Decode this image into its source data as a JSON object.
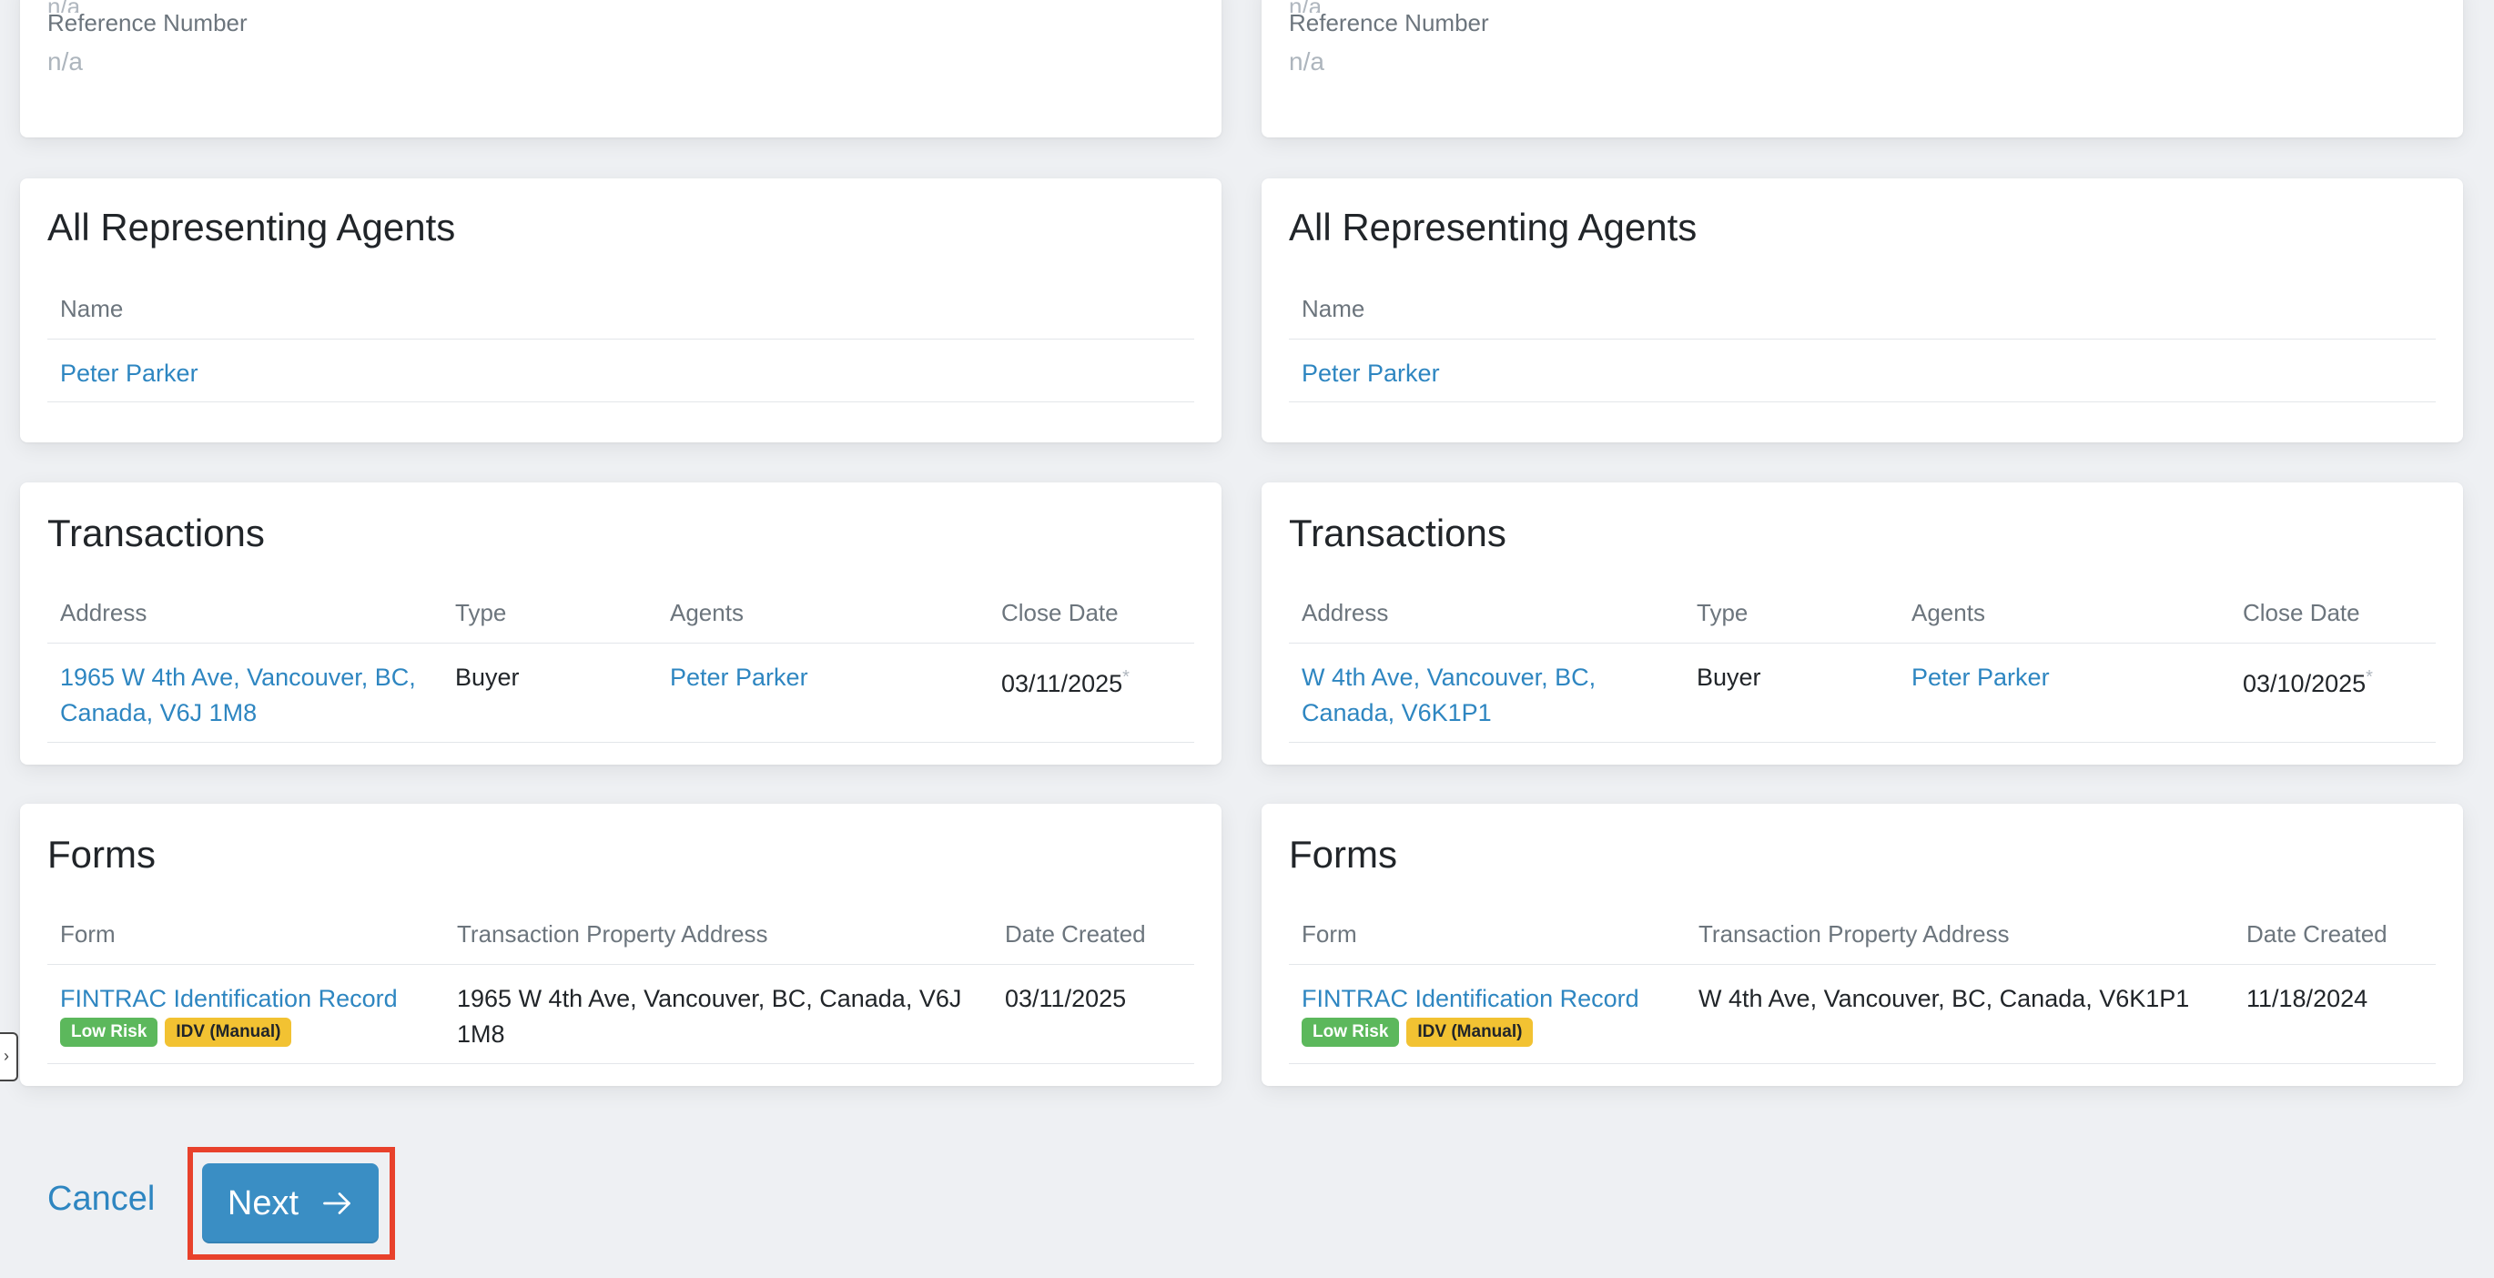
{
  "left": {
    "reference": {
      "faded_value": "n/a",
      "label": "Reference Number",
      "value": "n/a"
    },
    "agents": {
      "title": "All Representing Agents",
      "column_name": "Name",
      "rows": [
        {
          "name": "Peter Parker"
        }
      ]
    },
    "transactions": {
      "title": "Transactions",
      "columns": {
        "address": "Address",
        "type": "Type",
        "agents": "Agents",
        "close_date": "Close Date"
      },
      "rows": [
        {
          "address_line1": "1965 W 4th Ave, Vancouver, BC,",
          "address_line2": "Canada, V6J 1M8",
          "type": "Buyer",
          "agents": "Peter Parker",
          "close_date": "03/11/2025",
          "mark": "*"
        }
      ]
    },
    "forms": {
      "title": "Forms",
      "columns": {
        "form": "Form",
        "address": "Transaction Property Address",
        "date": "Date Created"
      },
      "rows": [
        {
          "form": "FINTRAC Identification Record",
          "badge_risk": "Low Risk",
          "badge_idv": "IDV (Manual)",
          "address_line1": "1965 W 4th Ave, Vancouver, BC, Canada, V6J",
          "address_line2": "1M8",
          "date": "03/11/2025"
        }
      ]
    }
  },
  "right": {
    "reference": {
      "faded_value": "n/a",
      "label": "Reference Number",
      "value": "n/a"
    },
    "agents": {
      "title": "All Representing Agents",
      "column_name": "Name",
      "rows": [
        {
          "name": "Peter Parker"
        }
      ]
    },
    "transactions": {
      "title": "Transactions",
      "columns": {
        "address": "Address",
        "type": "Type",
        "agents": "Agents",
        "close_date": "Close Date"
      },
      "rows": [
        {
          "address_line1": "W 4th Ave, Vancouver, BC,",
          "address_line2": "Canada, V6K1P1",
          "type": "Buyer",
          "agents": "Peter Parker",
          "close_date": "03/10/2025",
          "mark": "*"
        }
      ]
    },
    "forms": {
      "title": "Forms",
      "columns": {
        "form": "Form",
        "address": "Transaction Property Address",
        "date": "Date Created"
      },
      "rows": [
        {
          "form": "FINTRAC Identification Record",
          "badge_risk": "Low Risk",
          "badge_idv": "IDV (Manual)",
          "address_line1": "W 4th Ave, Vancouver, BC, Canada, V6K1P1",
          "address_line2": "",
          "date": "11/18/2024"
        }
      ]
    }
  },
  "footer": {
    "cancel_label": "Cancel",
    "next_label": "Next",
    "next_icon": "arrow-right-icon"
  },
  "sidebar_tab": {
    "icon": "chevron-right-icon",
    "glyph": "›"
  },
  "colors": {
    "link": "#2e86c1",
    "primary_button": "#3a8ec4",
    "badge_low_risk": "#5cb85c",
    "badge_idv": "#f2c232",
    "highlight": "#e8412b"
  }
}
